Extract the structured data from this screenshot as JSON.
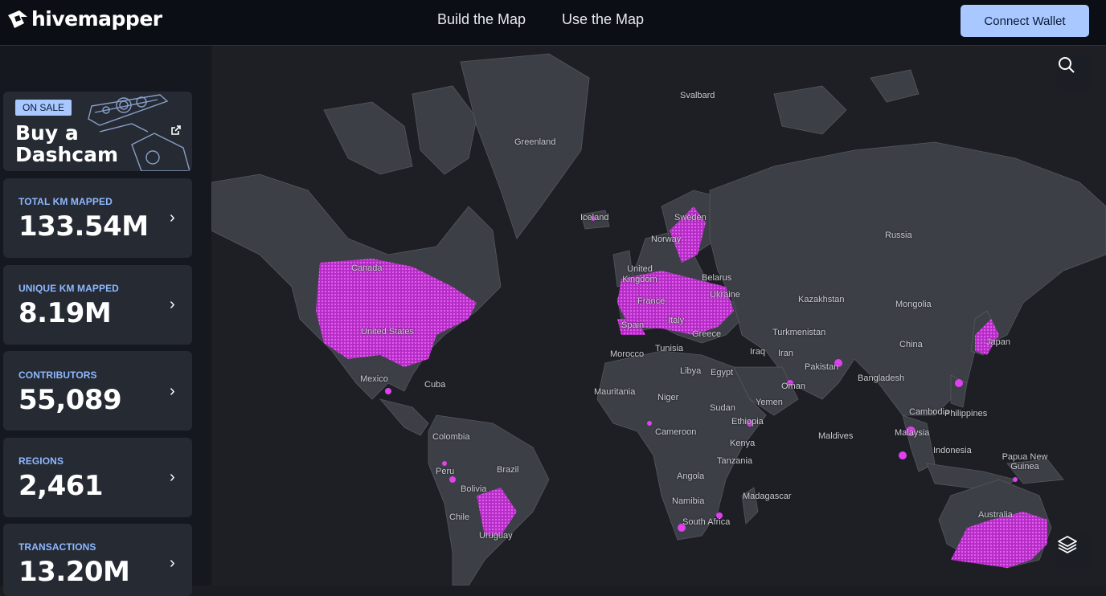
{
  "header": {
    "logo_text": "hivemapper",
    "nav": [
      "Build the Map",
      "Use the Map"
    ],
    "connect_label": "Connect Wallet"
  },
  "promo": {
    "badge": "ON SALE",
    "title": "Buy a Dashcam",
    "icon": "external-link-icon"
  },
  "stats": [
    {
      "label": "TOTAL KM MAPPED",
      "value": "133.54M"
    },
    {
      "label": "UNIQUE KM MAPPED",
      "value": "8.19M"
    },
    {
      "label": "CONTRIBUTORS",
      "value": "55,089"
    },
    {
      "label": "REGIONS",
      "value": "2,461"
    },
    {
      "label": "TRANSACTIONS",
      "value": "13.20M"
    }
  ],
  "map": {
    "labels": [
      "Svalbard",
      "Greenland",
      "Iceland",
      "Sweden",
      "Norway",
      "Canada",
      "United Kingdom",
      "Belarus",
      "Russia",
      "France",
      "Ukraine",
      "Kazakhstan",
      "Mongolia",
      "Spain",
      "Italy",
      "Greece",
      "Turkmenistan",
      "United States",
      "Morocco",
      "Tunisia",
      "Iraq",
      "Iran",
      "China",
      "Japan",
      "Libya",
      "Egypt",
      "Pakistan",
      "Mexico",
      "Cuba",
      "Bangladesh",
      "Mauritania",
      "Niger",
      "Oman",
      "Sudan",
      "Yemen",
      "Cambodia",
      "Philippines",
      "Ethiopia",
      "Colombia",
      "Cameroon",
      "Maldives",
      "Malaysia",
      "Kenya",
      "Indonesia",
      "Papua New Guinea",
      "Peru",
      "Brazil",
      "Tanzania",
      "Bolivia",
      "Angola",
      "Madagascar",
      "Chile",
      "Namibia",
      "Australia",
      "South Africa",
      "Uruguay"
    ],
    "colors": {
      "land": "#3c3f46",
      "ocean": "#1e1f24",
      "coverage": "#e040f0"
    },
    "search_icon": "search-icon",
    "layers_icon": "layers-icon"
  }
}
